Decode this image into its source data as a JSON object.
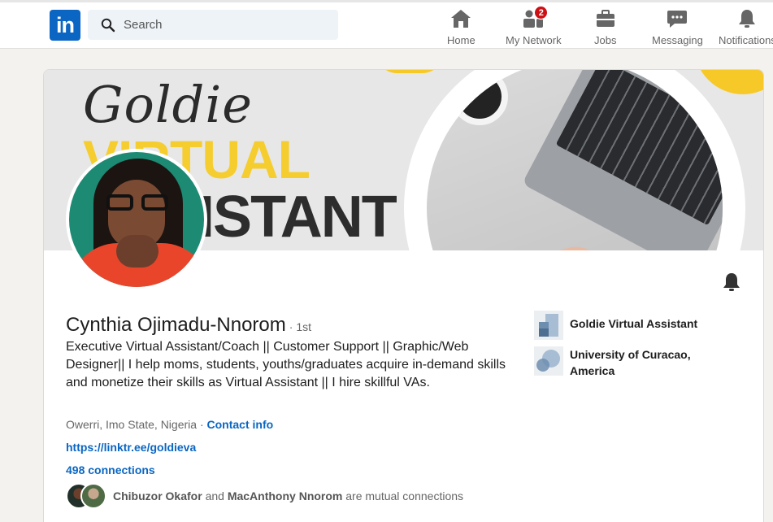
{
  "nav": {
    "logo_text": "in",
    "search_placeholder": "Search",
    "items": [
      {
        "label": "Home",
        "icon": "home-icon"
      },
      {
        "label": "My Network",
        "icon": "network-icon",
        "badge": "2"
      },
      {
        "label": "Jobs",
        "icon": "briefcase-icon"
      },
      {
        "label": "Messaging",
        "icon": "messaging-icon"
      },
      {
        "label": "Notifications",
        "icon": "bell-icon"
      }
    ]
  },
  "banner": {
    "script_text": "Goldie",
    "line1": "VIRTUAL",
    "line2": "ASSISTANT"
  },
  "profile": {
    "name": "Cynthia Ojimadu-Nnorom",
    "degree": "· 1st",
    "headline": "Executive Virtual Assistant/Coach || Customer Support || Graphic/Web Designer|| I help moms, students, youths/graduates acquire in-demand skills and monetize their skills as Virtual Assistant || I hire skillful VAs.",
    "location": "Owerri, Imo State, Nigeria ·",
    "contact_info": "Contact info",
    "website": "https://linktr.ee/goldieva",
    "connections": "498 connections",
    "mutual": {
      "person1": "Chibuzor Okafor",
      "and": "and",
      "person2": "MacAnthony Nnorom",
      "suffix": "are mutual connections"
    }
  },
  "affiliations": [
    {
      "name": "Goldie Virtual Assistant"
    },
    {
      "name": "University of Curacao, America"
    }
  ],
  "colors": {
    "brand": "#0a66c2",
    "badge": "#cc1016",
    "banner_yellow": "#f5cd2e"
  }
}
